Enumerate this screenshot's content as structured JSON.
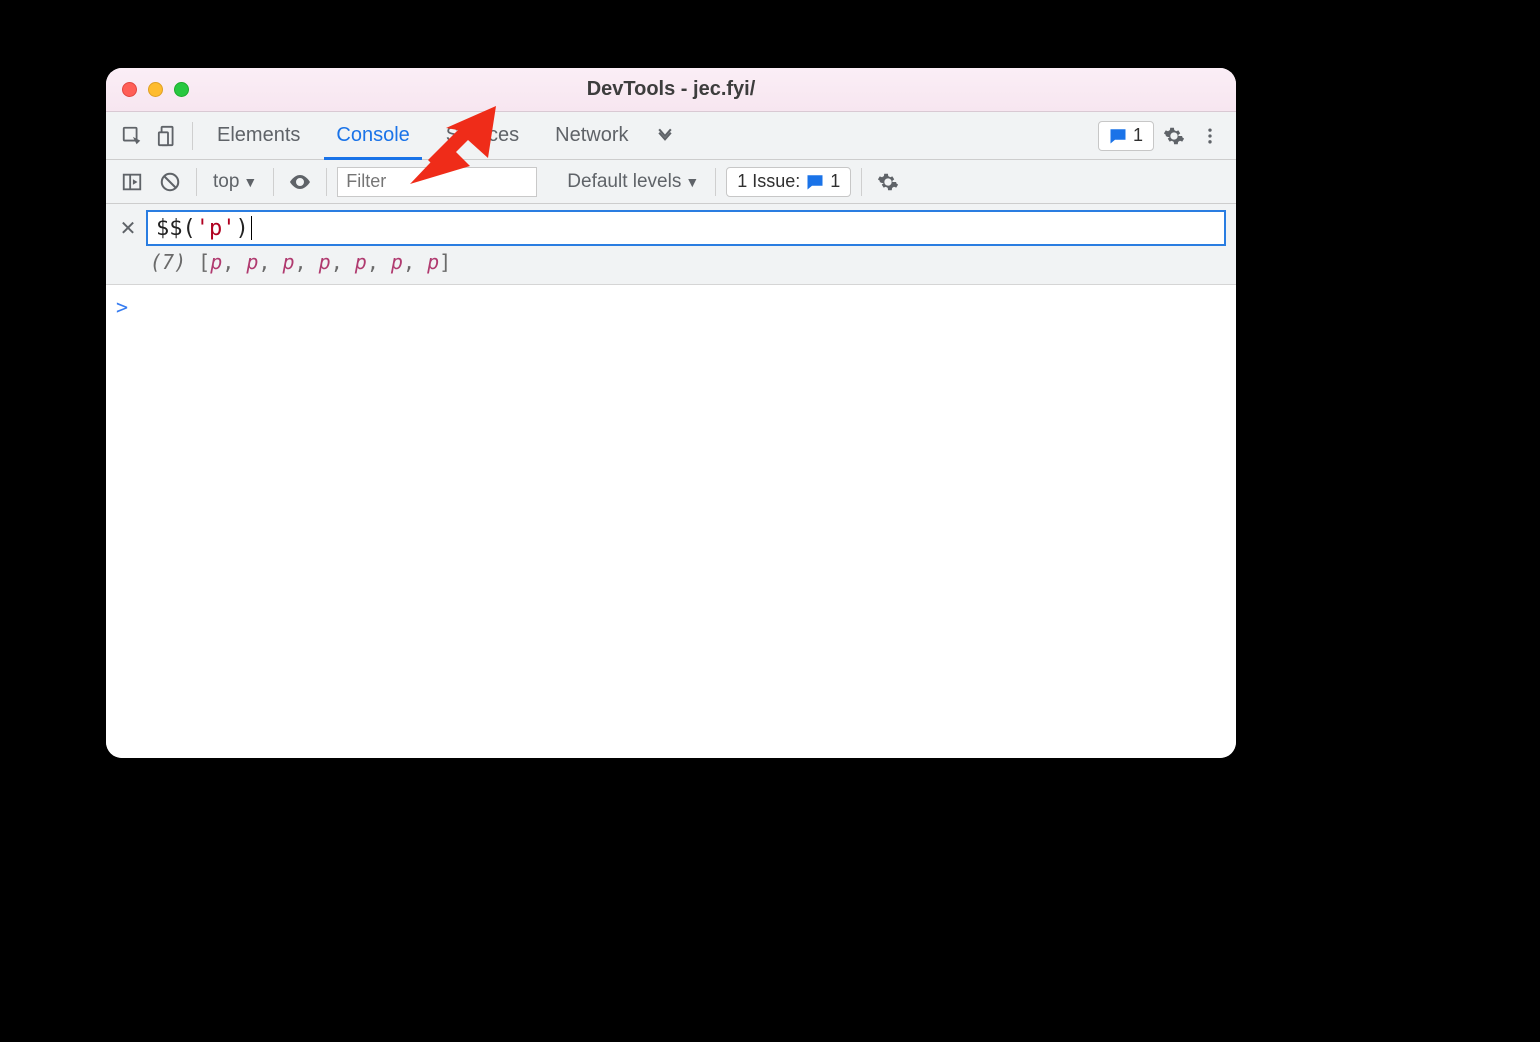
{
  "window_title": "DevTools - jec.fyi/",
  "tabs": {
    "elements": "Elements",
    "console": "Console",
    "sources": "Sources",
    "network": "Network"
  },
  "messages_count": "1",
  "subbar": {
    "context": "top",
    "filter_placeholder": "Filter",
    "levels": "Default levels",
    "issues_label": "1 Issue:",
    "issues_count": "1"
  },
  "expression": {
    "prefix": "$$",
    "open_paren": "(",
    "string": "'p'",
    "close_paren": ")"
  },
  "result": {
    "count": "(7)",
    "open": "[",
    "items": [
      "p",
      "p",
      "p",
      "p",
      "p",
      "p",
      "p"
    ],
    "close": "]"
  },
  "prompt_symbol": ">"
}
